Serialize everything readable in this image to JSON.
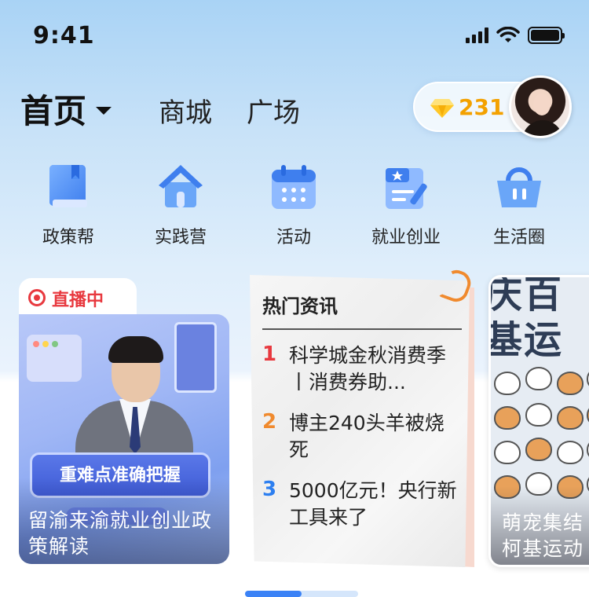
{
  "status_bar": {
    "time": "9:41"
  },
  "top_nav": {
    "home": "首页",
    "mall": "商城",
    "square": "广场",
    "points": "231"
  },
  "quick_links": [
    {
      "label": "政策帮",
      "icon": "book-icon"
    },
    {
      "label": "实践营",
      "icon": "house-icon"
    },
    {
      "label": "活动",
      "icon": "calendar-icon"
    },
    {
      "label": "就业创业",
      "icon": "id-card-icon"
    },
    {
      "label": "生活圈",
      "icon": "basket-icon"
    }
  ],
  "live_card": {
    "tag": "直播中",
    "banner": "重难点准确把握",
    "caption": "留渝来渝就业创业政策解读"
  },
  "news_card": {
    "title": "热门资讯",
    "items": [
      {
        "rank": "1",
        "text": "科学城金秋消费季丨消费券助...",
        "color": "#e8393f"
      },
      {
        "rank": "2",
        "text": "博主240头羊被烧死",
        "color": "#f08a2e"
      },
      {
        "rank": "3",
        "text": "5000亿元！央行新工具来了",
        "color": "#2d7ff0"
      }
    ]
  },
  "pet_card": {
    "caption_line1": "萌宠集结",
    "caption_line2": "柯基运动"
  },
  "pager": {
    "current": 1,
    "total": 2
  },
  "colors": {
    "accent": "#3b82f6",
    "live": "#e8393f",
    "points": "#f3a100"
  }
}
